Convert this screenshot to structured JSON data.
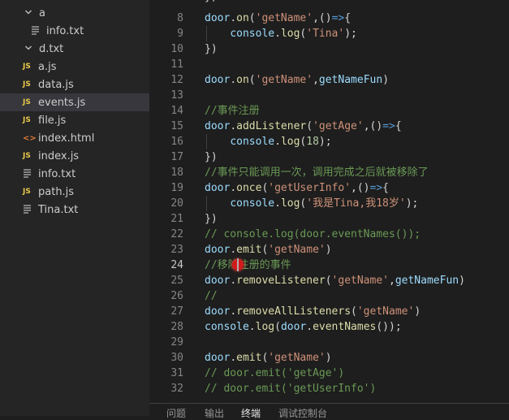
{
  "explorer": {
    "items": [
      {
        "label": "a",
        "kind": "folder",
        "icon": "chevron-down-icon",
        "indent": 1
      },
      {
        "label": "info.txt",
        "kind": "txt",
        "icon": "text-file-icon",
        "indent": 2
      },
      {
        "label": "d.txt",
        "kind": "folder",
        "icon": "chevron-down-icon",
        "indent": 1
      },
      {
        "label": "a.js",
        "kind": "js",
        "icon": "js-file-icon",
        "badge": "JS",
        "indent": 1
      },
      {
        "label": "data.js",
        "kind": "js",
        "icon": "js-file-icon",
        "badge": "JS",
        "indent": 1
      },
      {
        "label": "events.js",
        "kind": "js",
        "icon": "js-file-icon",
        "badge": "JS",
        "indent": 1,
        "selected": true
      },
      {
        "label": "file.js",
        "kind": "js",
        "icon": "js-file-icon",
        "badge": "JS",
        "indent": 1
      },
      {
        "label": "index.html",
        "kind": "html",
        "icon": "html-file-icon",
        "badge": "<>",
        "indent": 1
      },
      {
        "label": "index.js",
        "kind": "js",
        "icon": "js-file-icon",
        "badge": "JS",
        "indent": 1
      },
      {
        "label": "info.txt",
        "kind": "txt",
        "icon": "text-file-icon",
        "indent": 1
      },
      {
        "label": "path.js",
        "kind": "js",
        "icon": "js-file-icon",
        "badge": "JS",
        "indent": 1
      },
      {
        "label": "Tina.txt",
        "kind": "txt",
        "icon": "text-file-icon",
        "indent": 1
      }
    ]
  },
  "editor": {
    "current_line": 24,
    "lines": [
      {
        "n": "8",
        "tokens": [
          [
            "door",
            "var"
          ],
          [
            ".",
            "punc"
          ],
          [
            "on",
            "fn"
          ],
          [
            "(",
            "punc"
          ],
          [
            "'getName'",
            "str"
          ],
          [
            ",()",
            "punc"
          ],
          [
            "=>",
            "arrow"
          ],
          [
            "{",
            "punc"
          ]
        ]
      },
      {
        "n": "9",
        "tokens": [
          [
            "    ",
            "punc"
          ],
          [
            "console",
            "var"
          ],
          [
            ".",
            "punc"
          ],
          [
            "log",
            "fn"
          ],
          [
            "(",
            "punc"
          ],
          [
            "'Tina'",
            "str"
          ],
          [
            ");",
            "punc"
          ]
        ]
      },
      {
        "n": "10",
        "tokens": [
          [
            "})",
            "punc"
          ]
        ]
      },
      {
        "n": "11",
        "tokens": []
      },
      {
        "n": "12",
        "tokens": [
          [
            "door",
            "var"
          ],
          [
            ".",
            "punc"
          ],
          [
            "on",
            "fn"
          ],
          [
            "(",
            "punc"
          ],
          [
            "'getName'",
            "str"
          ],
          [
            ",",
            "punc"
          ],
          [
            "getNameFun",
            "var"
          ],
          [
            ")",
            "punc"
          ]
        ]
      },
      {
        "n": "13",
        "tokens": []
      },
      {
        "n": "14",
        "tokens": [
          [
            "//事件注册",
            "cmt"
          ]
        ]
      },
      {
        "n": "15",
        "tokens": [
          [
            "door",
            "var"
          ],
          [
            ".",
            "punc"
          ],
          [
            "addListener",
            "fn"
          ],
          [
            "(",
            "punc"
          ],
          [
            "'getAge'",
            "str"
          ],
          [
            ",()",
            "punc"
          ],
          [
            "=>",
            "arrow"
          ],
          [
            "{",
            "punc"
          ]
        ]
      },
      {
        "n": "16",
        "tokens": [
          [
            "    ",
            "punc"
          ],
          [
            "console",
            "var"
          ],
          [
            ".",
            "punc"
          ],
          [
            "log",
            "fn"
          ],
          [
            "(",
            "punc"
          ],
          [
            "18",
            "num"
          ],
          [
            ");",
            "punc"
          ]
        ]
      },
      {
        "n": "17",
        "tokens": [
          [
            "})",
            "punc"
          ]
        ]
      },
      {
        "n": "18",
        "tokens": [
          [
            "//事件只能调用一次，调用完成之后就被移除了",
            "cmt"
          ]
        ]
      },
      {
        "n": "19",
        "tokens": [
          [
            "door",
            "var"
          ],
          [
            ".",
            "punc"
          ],
          [
            "once",
            "fn"
          ],
          [
            "(",
            "punc"
          ],
          [
            "'getUserInfo'",
            "str"
          ],
          [
            ",()",
            "punc"
          ],
          [
            "=>",
            "arrow"
          ],
          [
            "{",
            "punc"
          ]
        ]
      },
      {
        "n": "20",
        "tokens": [
          [
            "    ",
            "punc"
          ],
          [
            "console",
            "var"
          ],
          [
            ".",
            "punc"
          ],
          [
            "log",
            "fn"
          ],
          [
            "(",
            "punc"
          ],
          [
            "'我是Tina,我18岁'",
            "str"
          ],
          [
            ");",
            "punc"
          ]
        ]
      },
      {
        "n": "21",
        "tokens": [
          [
            "})",
            "punc"
          ]
        ]
      },
      {
        "n": "22",
        "tokens": [
          [
            "// console.log(door.eventNames());",
            "cmt"
          ]
        ]
      },
      {
        "n": "23",
        "tokens": [
          [
            "door",
            "var"
          ],
          [
            ".",
            "punc"
          ],
          [
            "emit",
            "fn"
          ],
          [
            "(",
            "punc"
          ],
          [
            "'getName'",
            "str"
          ],
          [
            ")",
            "punc"
          ]
        ]
      },
      {
        "n": "24",
        "tokens": [
          [
            "//移除注册的事件",
            "cmt"
          ]
        ]
      },
      {
        "n": "25",
        "tokens": [
          [
            "door",
            "var"
          ],
          [
            ".",
            "punc"
          ],
          [
            "removeListener",
            "fn"
          ],
          [
            "(",
            "punc"
          ],
          [
            "'getName'",
            "str"
          ],
          [
            ",",
            "punc"
          ],
          [
            "getNameFun",
            "var"
          ],
          [
            ")",
            "punc"
          ]
        ]
      },
      {
        "n": "26",
        "tokens": [
          [
            "//",
            "cmt"
          ]
        ]
      },
      {
        "n": "27",
        "tokens": [
          [
            "door",
            "var"
          ],
          [
            ".",
            "punc"
          ],
          [
            "removeAllListeners",
            "fn"
          ],
          [
            "(",
            "punc"
          ],
          [
            "'getName'",
            "str"
          ],
          [
            ")",
            "punc"
          ]
        ]
      },
      {
        "n": "28",
        "tokens": [
          [
            "console",
            "var"
          ],
          [
            ".",
            "punc"
          ],
          [
            "log",
            "fn"
          ],
          [
            "(",
            "punc"
          ],
          [
            "door",
            "var"
          ],
          [
            ".",
            "punc"
          ],
          [
            "eventNames",
            "fn"
          ],
          [
            "());",
            "punc"
          ]
        ]
      },
      {
        "n": "29",
        "tokens": []
      },
      {
        "n": "30",
        "tokens": [
          [
            "door",
            "var"
          ],
          [
            ".",
            "punc"
          ],
          [
            "emit",
            "fn"
          ],
          [
            "(",
            "punc"
          ],
          [
            "'getName'",
            "str"
          ],
          [
            ")",
            "punc"
          ]
        ]
      },
      {
        "n": "31",
        "tokens": [
          [
            "// door.emit('getAge')",
            "cmt"
          ]
        ]
      },
      {
        "n": "32",
        "tokens": [
          [
            "// door.emit('getUserInfo')",
            "cmt"
          ]
        ]
      }
    ]
  },
  "panel": {
    "tabs": [
      {
        "label": "问题",
        "name": "tab-problems"
      },
      {
        "label": "输出",
        "name": "tab-output"
      },
      {
        "label": "终端",
        "name": "tab-terminal",
        "active": true
      },
      {
        "label": "调试控制台",
        "name": "tab-debug-console"
      }
    ]
  },
  "colors": {
    "sidebar_bg": "#252526",
    "editor_bg": "#1e1e1e",
    "selected_row": "#37373d",
    "cursor_highlight": "#d21a1a"
  }
}
